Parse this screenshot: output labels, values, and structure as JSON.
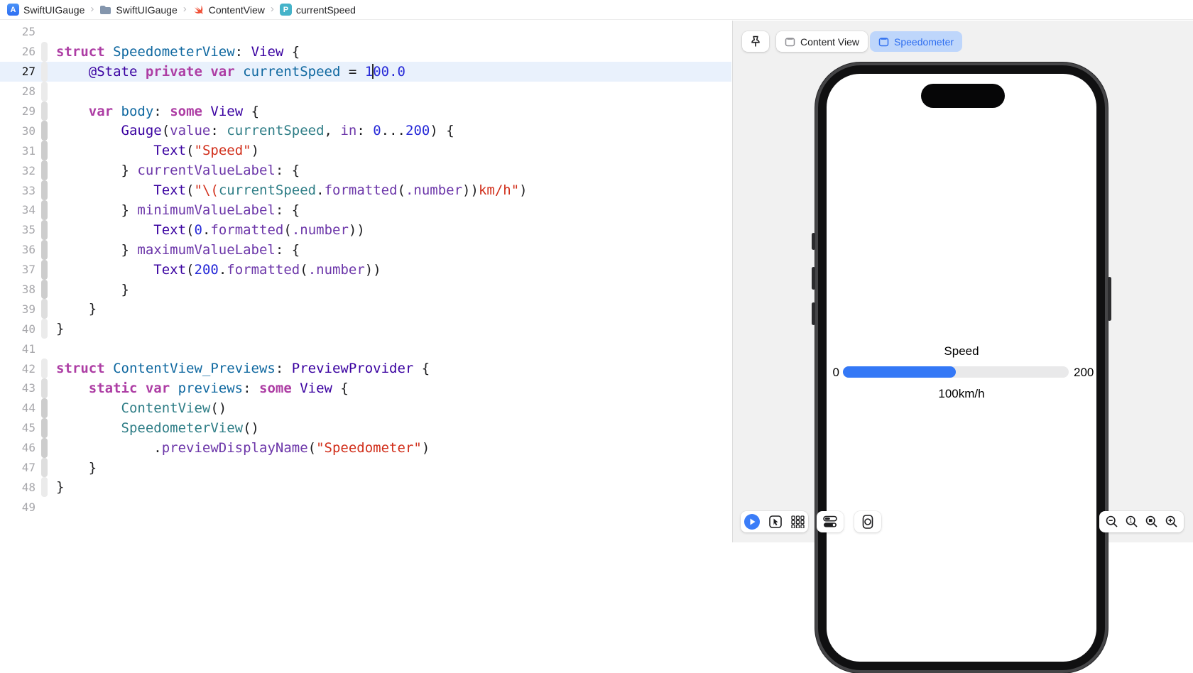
{
  "breadcrumb": {
    "separator": "›",
    "items": [
      {
        "icon": "app-icon",
        "label": "SwiftUIGauge"
      },
      {
        "icon": "folder-icon",
        "label": "SwiftUIGauge"
      },
      {
        "icon": "swift-file-icon",
        "label": "ContentView"
      },
      {
        "icon": "property-icon",
        "label": "currentSpeed"
      }
    ],
    "app_badge_letter": "A",
    "property_badge_letter": "P"
  },
  "editor": {
    "current_line": 27,
    "lines": [
      {
        "num": 25,
        "depth": 0,
        "pad": 0,
        "segs": []
      },
      {
        "num": 26,
        "depth": 1,
        "pad": 0,
        "segs": [
          [
            "kw",
            "struct "
          ],
          [
            "decl",
            "SpeedometerView"
          ],
          [
            "plain",
            ": "
          ],
          [
            "type",
            "View"
          ],
          [
            "plain",
            " {"
          ]
        ]
      },
      {
        "num": 27,
        "depth": 1,
        "pad": 4,
        "segs": [
          [
            "type",
            "@State "
          ],
          [
            "kw",
            "private "
          ],
          [
            "kw",
            "var "
          ],
          [
            "decl",
            "currentSpeed"
          ],
          [
            "plain",
            " = "
          ],
          [
            "num",
            "1"
          ],
          [
            "caret",
            ""
          ],
          [
            "num",
            "00.0"
          ]
        ]
      },
      {
        "num": 28,
        "depth": 1,
        "pad": 0,
        "segs": []
      },
      {
        "num": 29,
        "depth": 2,
        "pad": 4,
        "segs": [
          [
            "kw",
            "var "
          ],
          [
            "decl",
            "body"
          ],
          [
            "plain",
            ": "
          ],
          [
            "kw",
            "some "
          ],
          [
            "type",
            "View"
          ],
          [
            "plain",
            " {"
          ]
        ]
      },
      {
        "num": 30,
        "depth": 3,
        "pad": 8,
        "segs": [
          [
            "type",
            "Gauge"
          ],
          [
            "plain",
            "("
          ],
          [
            "fn",
            "value"
          ],
          [
            "plain",
            ": "
          ],
          [
            "ref",
            "currentSpeed"
          ],
          [
            "plain",
            ", "
          ],
          [
            "fn",
            "in"
          ],
          [
            "plain",
            ": "
          ],
          [
            "num",
            "0"
          ],
          [
            "plain",
            "..."
          ],
          [
            "num",
            "200"
          ],
          [
            "plain",
            ") {"
          ]
        ]
      },
      {
        "num": 31,
        "depth": 3,
        "pad": 12,
        "segs": [
          [
            "type",
            "Text"
          ],
          [
            "plain",
            "("
          ],
          [
            "str",
            "\"Speed\""
          ],
          [
            "plain",
            ")"
          ]
        ]
      },
      {
        "num": 32,
        "depth": 3,
        "pad": 8,
        "segs": [
          [
            "plain",
            "} "
          ],
          [
            "fn",
            "currentValueLabel"
          ],
          [
            "plain",
            ": {"
          ]
        ]
      },
      {
        "num": 33,
        "depth": 3,
        "pad": 12,
        "segs": [
          [
            "type",
            "Text"
          ],
          [
            "plain",
            "("
          ],
          [
            "str",
            "\"\\("
          ],
          [
            "ref",
            "currentSpeed"
          ],
          [
            "plain",
            "."
          ],
          [
            "fn",
            "formatted"
          ],
          [
            "plain",
            "("
          ],
          [
            "fn",
            ".number"
          ],
          [
            "plain",
            "))"
          ],
          [
            "str",
            "km/h\""
          ],
          [
            "plain",
            ")"
          ]
        ]
      },
      {
        "num": 34,
        "depth": 3,
        "pad": 8,
        "segs": [
          [
            "plain",
            "} "
          ],
          [
            "fn",
            "minimumValueLabel"
          ],
          [
            "plain",
            ": {"
          ]
        ]
      },
      {
        "num": 35,
        "depth": 3,
        "pad": 12,
        "segs": [
          [
            "type",
            "Text"
          ],
          [
            "plain",
            "("
          ],
          [
            "num",
            "0"
          ],
          [
            "plain",
            "."
          ],
          [
            "fn",
            "formatted"
          ],
          [
            "plain",
            "("
          ],
          [
            "fn",
            ".number"
          ],
          [
            "plain",
            "))"
          ]
        ]
      },
      {
        "num": 36,
        "depth": 3,
        "pad": 8,
        "segs": [
          [
            "plain",
            "} "
          ],
          [
            "fn",
            "maximumValueLabel"
          ],
          [
            "plain",
            ": {"
          ]
        ]
      },
      {
        "num": 37,
        "depth": 3,
        "pad": 12,
        "segs": [
          [
            "type",
            "Text"
          ],
          [
            "plain",
            "("
          ],
          [
            "num",
            "200"
          ],
          [
            "plain",
            "."
          ],
          [
            "fn",
            "formatted"
          ],
          [
            "plain",
            "("
          ],
          [
            "fn",
            ".number"
          ],
          [
            "plain",
            "))"
          ]
        ]
      },
      {
        "num": 38,
        "depth": 3,
        "pad": 8,
        "segs": [
          [
            "plain",
            "}"
          ]
        ]
      },
      {
        "num": 39,
        "depth": 2,
        "pad": 4,
        "segs": [
          [
            "plain",
            "}"
          ]
        ]
      },
      {
        "num": 40,
        "depth": 1,
        "pad": 0,
        "segs": [
          [
            "plain",
            "}"
          ]
        ]
      },
      {
        "num": 41,
        "depth": 0,
        "pad": 0,
        "segs": []
      },
      {
        "num": 42,
        "depth": 1,
        "pad": 0,
        "segs": [
          [
            "kw",
            "struct "
          ],
          [
            "decl",
            "ContentView_Previews"
          ],
          [
            "plain",
            ": "
          ],
          [
            "type",
            "PreviewProvider"
          ],
          [
            "plain",
            " {"
          ]
        ]
      },
      {
        "num": 43,
        "depth": 2,
        "pad": 4,
        "segs": [
          [
            "kw",
            "static "
          ],
          [
            "kw",
            "var "
          ],
          [
            "decl",
            "previews"
          ],
          [
            "plain",
            ": "
          ],
          [
            "kw",
            "some "
          ],
          [
            "type",
            "View"
          ],
          [
            "plain",
            " {"
          ]
        ]
      },
      {
        "num": 44,
        "depth": 3,
        "pad": 8,
        "segs": [
          [
            "ref",
            "ContentView"
          ],
          [
            "plain",
            "()"
          ]
        ]
      },
      {
        "num": 45,
        "depth": 3,
        "pad": 8,
        "segs": [
          [
            "ref",
            "SpeedometerView"
          ],
          [
            "plain",
            "()"
          ]
        ]
      },
      {
        "num": 46,
        "depth": 3,
        "pad": 12,
        "segs": [
          [
            "plain",
            "."
          ],
          [
            "fn",
            "previewDisplayName"
          ],
          [
            "plain",
            "("
          ],
          [
            "str",
            "\"Speedometer\""
          ],
          [
            "plain",
            ")"
          ]
        ]
      },
      {
        "num": 47,
        "depth": 2,
        "pad": 4,
        "segs": [
          [
            "plain",
            "}"
          ]
        ]
      },
      {
        "num": 48,
        "depth": 1,
        "pad": 0,
        "segs": [
          [
            "plain",
            "}"
          ]
        ]
      },
      {
        "num": 49,
        "depth": 0,
        "pad": 0,
        "segs": []
      }
    ],
    "syntax_colors": {
      "keyword": "#ad3da4",
      "type": "#3900a0",
      "function": "#6c36a9",
      "declaration": "#0f68a0",
      "project_reference": "#2e7d86",
      "number": "#272ad8",
      "string": "#d12f1b",
      "plain": "#1d1d1f",
      "current_line_highlight": "#e9f1fc"
    }
  },
  "canvas": {
    "tabs": [
      {
        "label": "Content View",
        "selected": false
      },
      {
        "label": "Speedometer",
        "selected": true
      }
    ],
    "selected_tab_bg": "#bed6fb",
    "selected_tab_color": "#2f6ff0",
    "toolbar": {
      "buttons": [
        "live-preview",
        "selectable-mode",
        "variants",
        "device-settings",
        "device-bezels"
      ],
      "zoom_buttons": [
        "zoom-out",
        "zoom-100",
        "zoom-to-fit",
        "zoom-in"
      ],
      "play_color": "#3b7df8"
    }
  },
  "preview": {
    "gauge": {
      "title": "Speed",
      "min_label": "0",
      "max_label": "200",
      "current_label": "100km/h",
      "progress": 0.5,
      "bar_color": "#3478f6",
      "track_color": "#e9e9ea"
    }
  }
}
